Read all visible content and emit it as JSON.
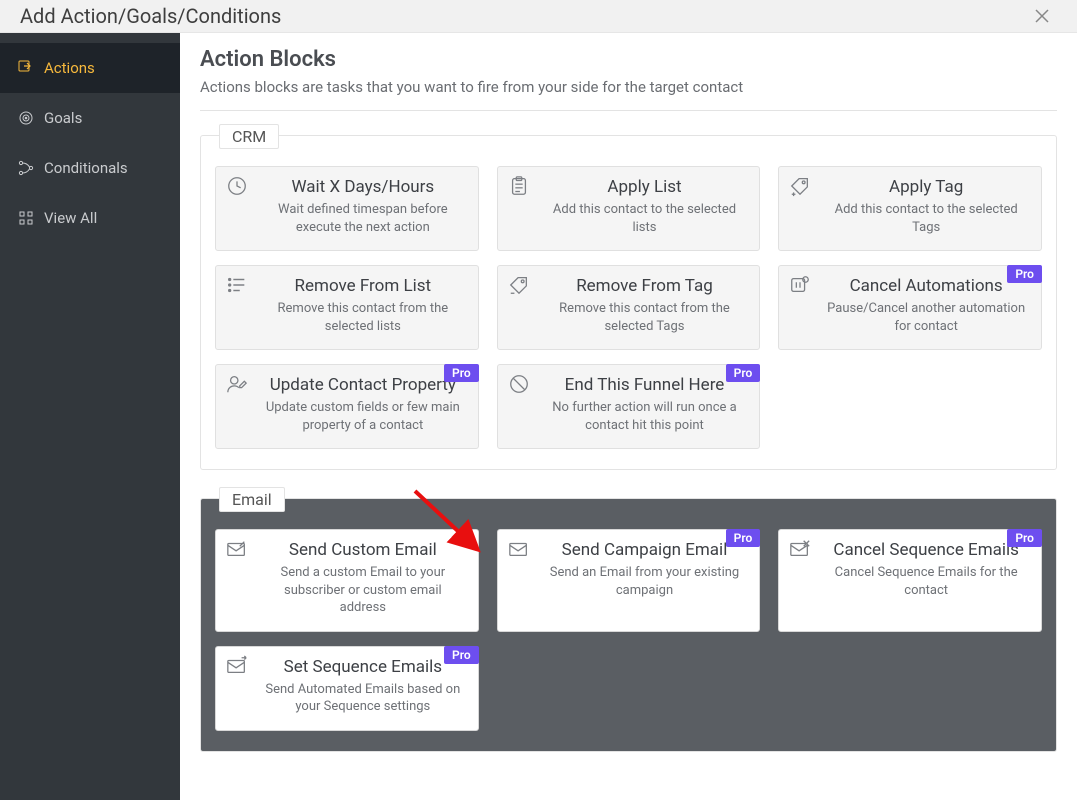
{
  "titlebar": {
    "title": "Add Action/Goals/Conditions"
  },
  "sidebar": {
    "items": [
      {
        "label": "Actions"
      },
      {
        "label": "Goals"
      },
      {
        "label": "Conditionals"
      },
      {
        "label": "View All"
      }
    ]
  },
  "page": {
    "heading": "Action Blocks",
    "subheading": "Actions blocks are tasks that you want to fire from your side for the target contact"
  },
  "badges": {
    "pro": "Pro"
  },
  "sections": {
    "crm": {
      "legend": "CRM",
      "cards": [
        {
          "title": "Wait X Days/Hours",
          "desc": "Wait defined timespan before execute the next action"
        },
        {
          "title": "Apply List",
          "desc": "Add this contact to the selected lists"
        },
        {
          "title": "Apply Tag",
          "desc": "Add this contact to the selected Tags"
        },
        {
          "title": "Remove From List",
          "desc": "Remove this contact from the selected lists"
        },
        {
          "title": "Remove From Tag",
          "desc": "Remove this contact from the selected Tags"
        },
        {
          "title": "Cancel Automations",
          "desc": "Pause/Cancel another automation for contact"
        },
        {
          "title": "Update Contact Property",
          "desc": "Update custom fields or few main property of a contact"
        },
        {
          "title": "End This Funnel Here",
          "desc": "No further action will run once a contact hit this point"
        }
      ]
    },
    "email": {
      "legend": "Email",
      "cards": [
        {
          "title": "Send Custom Email",
          "desc": "Send a custom Email to your subscriber or custom email address"
        },
        {
          "title": "Send Campaign Email",
          "desc": "Send an Email from your existing campaign"
        },
        {
          "title": "Cancel Sequence Emails",
          "desc": "Cancel Sequence Emails for the contact"
        },
        {
          "title": "Set Sequence Emails",
          "desc": "Send Automated Emails based on your Sequence settings"
        }
      ]
    }
  }
}
